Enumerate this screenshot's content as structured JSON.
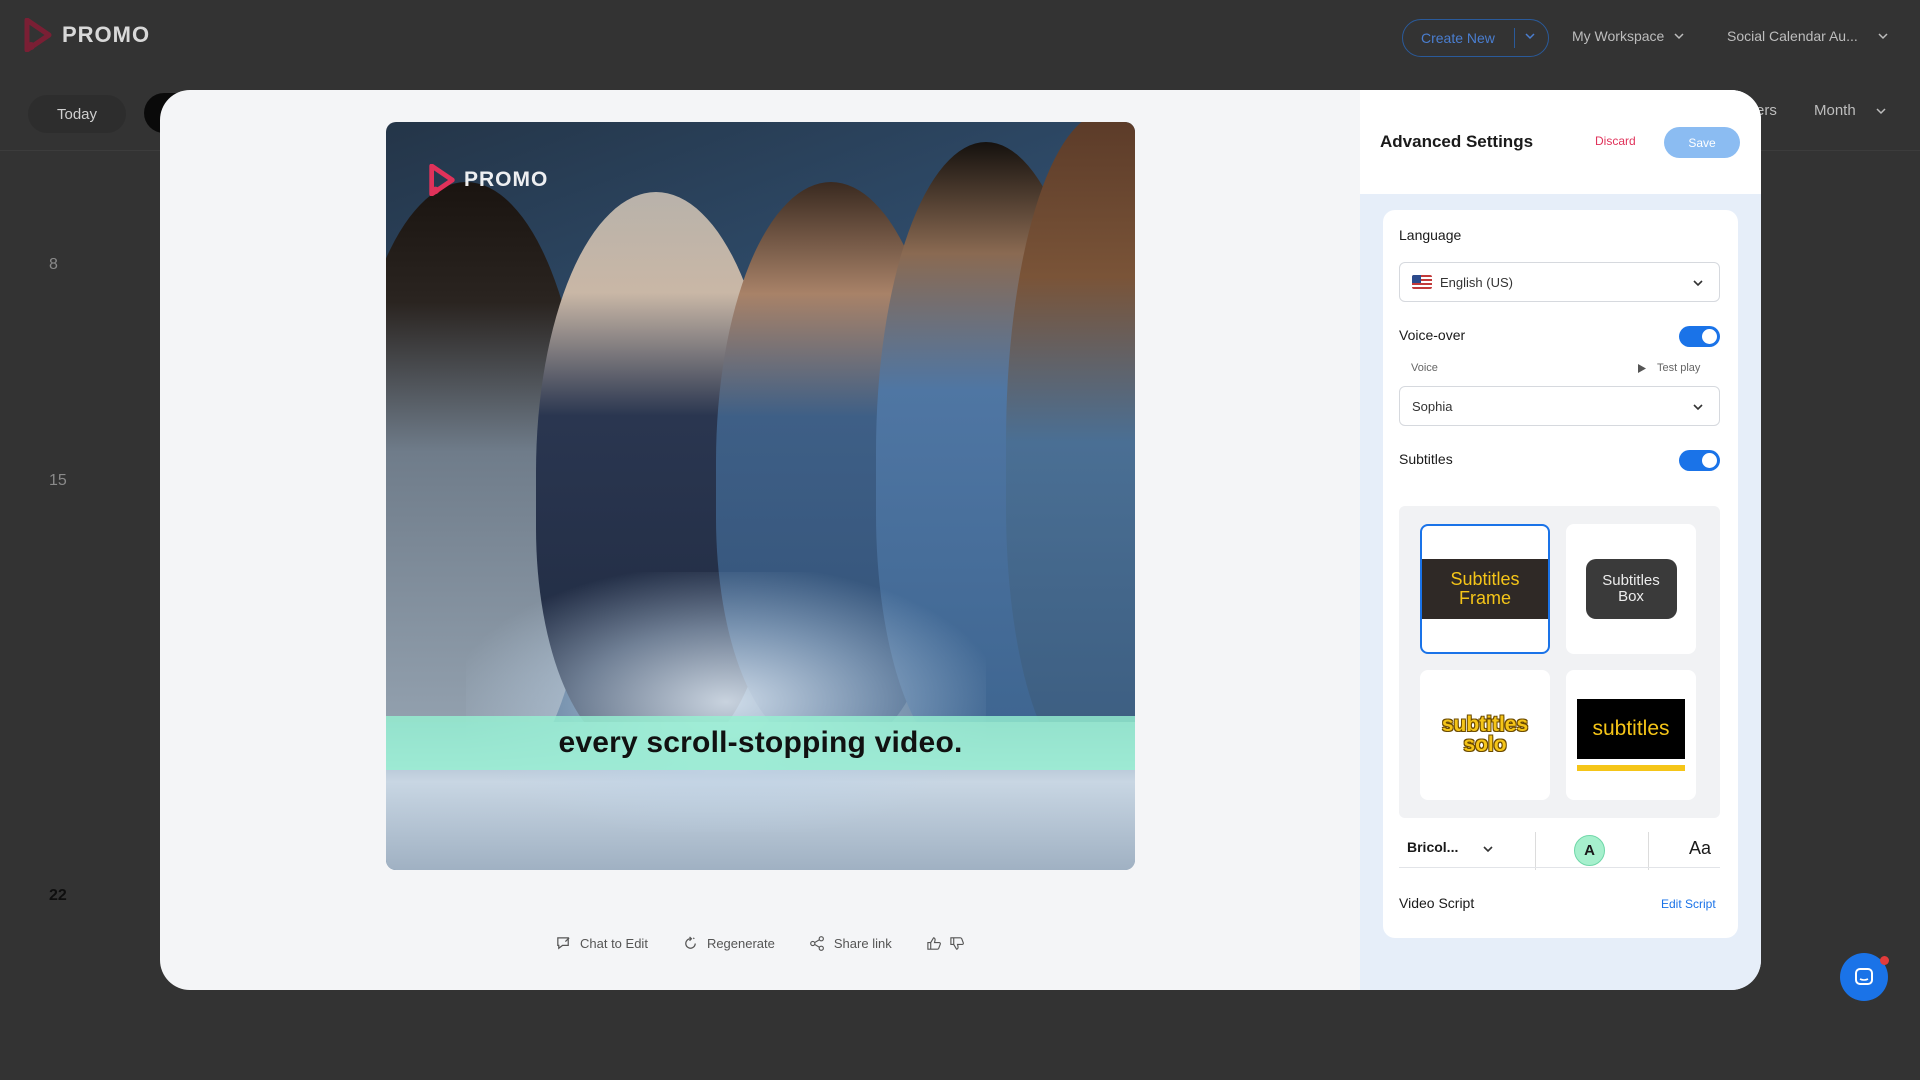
{
  "app": {
    "logo_text": "PROMO",
    "brand_color": "#e0325a",
    "accent_color": "#1a73e8"
  },
  "topbar": {
    "create_new": "Create New",
    "workspace": "My Workspace",
    "calendar": "Social Calendar Au..."
  },
  "calendar": {
    "today": "Today",
    "filters_partial": "ers",
    "view": "Month",
    "days": [
      "8",
      "15",
      "22"
    ]
  },
  "preview": {
    "logo_text": "PROMO",
    "caption": "every scroll-stopping video.",
    "caption_band_color": "#96f0d2"
  },
  "actions": {
    "chat": "Chat to Edit",
    "regenerate": "Regenerate",
    "share": "Share link"
  },
  "panel": {
    "title": "Advanced Settings",
    "discard": "Discard",
    "save": "Save",
    "language_label": "Language",
    "language_value": "English (US)",
    "voiceover_label": "Voice-over",
    "voiceover_on": true,
    "voice_label": "Voice",
    "test_play": "Test play",
    "voice_value": "Sophia",
    "subtitles_label": "Subtitles",
    "subtitles_on": true,
    "styles": [
      {
        "line1": "Subtitles",
        "line2": "Frame",
        "selected": true
      },
      {
        "line1": "Subtitles",
        "line2": "Box",
        "selected": false
      },
      {
        "line1": "subtitles",
        "line2": "solo",
        "selected": false
      },
      {
        "line1": "subtitles",
        "line2": "",
        "selected": false
      }
    ],
    "font_name": "Bricol...",
    "color_letter": "A",
    "font_icon": "Aa",
    "video_script_label": "Video Script",
    "edit_script": "Edit Script"
  }
}
